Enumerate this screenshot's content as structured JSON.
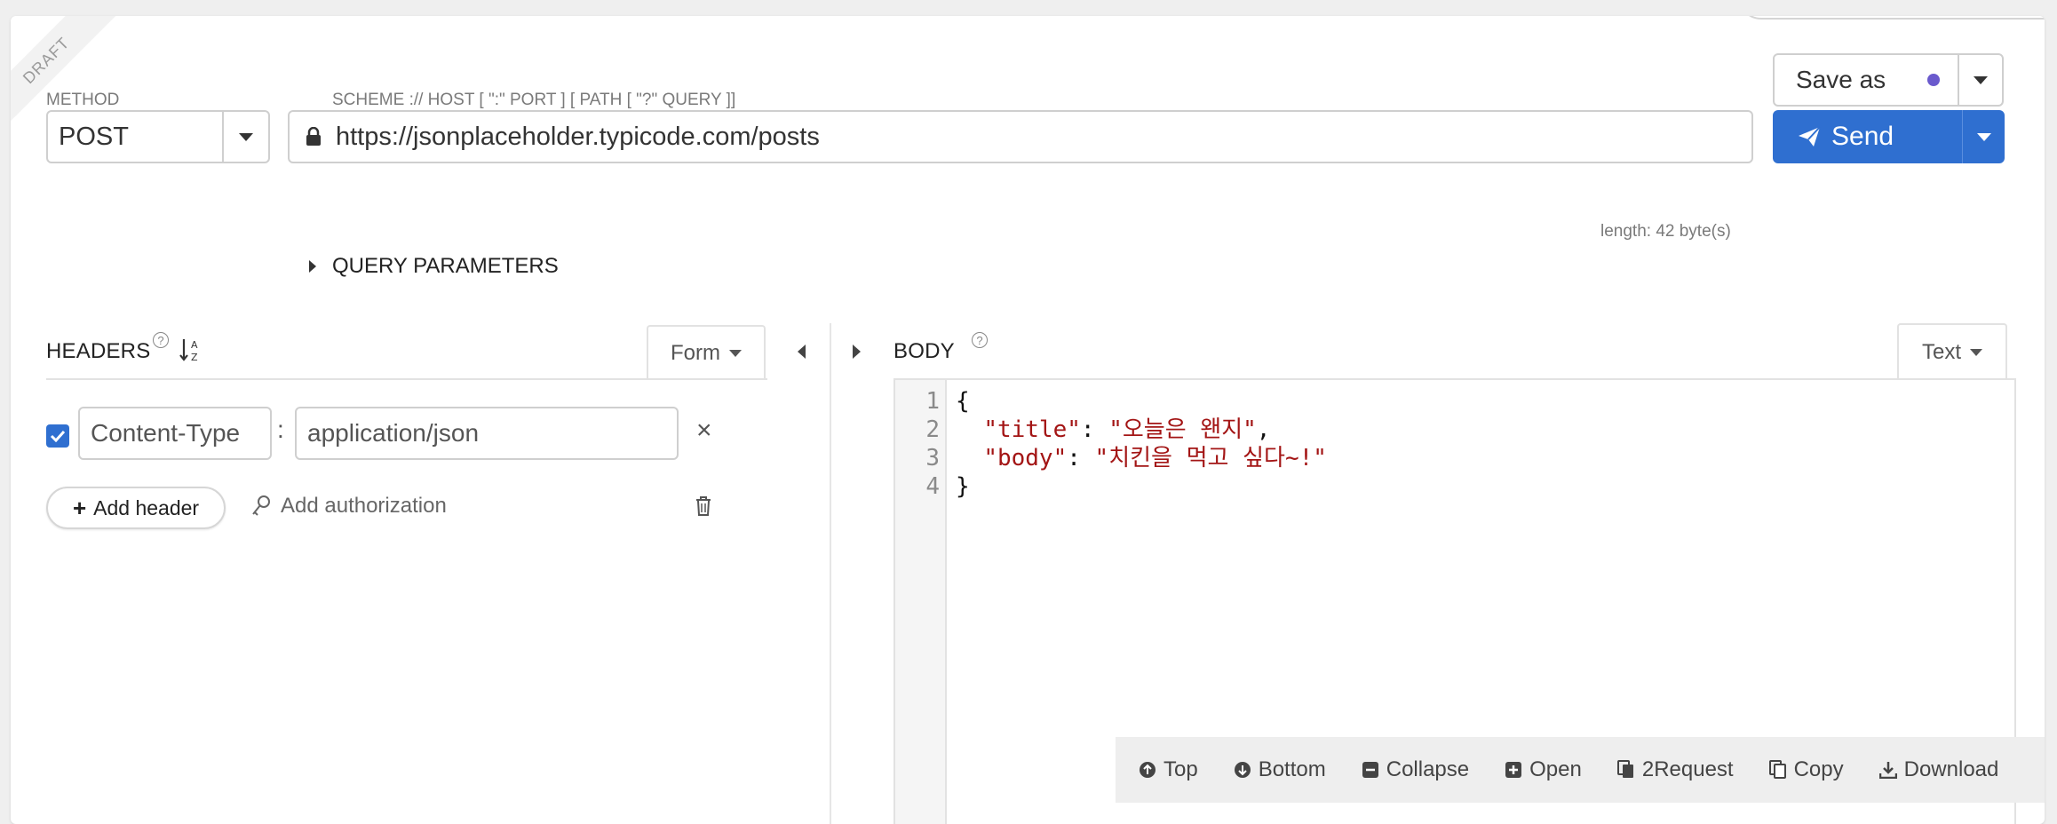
{
  "draft_label": "DRAFT",
  "save": {
    "label": "Save as"
  },
  "method": {
    "label": "METHOD",
    "value": "POST"
  },
  "url": {
    "label": "SCHEME :// HOST [ \":\" PORT ] [ PATH [ \"?\" QUERY ]]",
    "value": "https://jsonplaceholder.typicode.com/posts",
    "length": "length: 42 byte(s)"
  },
  "send": {
    "label": "Send"
  },
  "query_params": {
    "label": "QUERY PARAMETERS"
  },
  "headers": {
    "title": "HEADERS",
    "mode": "Form",
    "rows": [
      {
        "enabled": true,
        "name": "Content-Type",
        "separator": ":",
        "value": "application/json"
      }
    ],
    "add_header": "Add header",
    "add_auth": "Add authorization"
  },
  "body": {
    "title": "BODY",
    "mode": "Text",
    "line_numbers": [
      "1",
      "2",
      "3",
      "4"
    ],
    "lines": [
      {
        "text": "{"
      },
      {
        "key": "\"title\"",
        "sep": ": ",
        "val": "\"오늘은 왠지\"",
        "end": ","
      },
      {
        "key": "\"body\"",
        "sep": ": ",
        "val": "\"치킨을 먹고 싶다~!\"",
        "end": ""
      },
      {
        "text": "}"
      }
    ]
  },
  "toolbar": {
    "top": "Top",
    "bottom": "Bottom",
    "collapse": "Collapse",
    "open": "Open",
    "to_request": "2Request",
    "copy": "Copy",
    "download": "Download"
  },
  "colors": {
    "accent": "#2f6fd0",
    "save_dot": "#6a5acd",
    "code_string": "#a31515"
  }
}
